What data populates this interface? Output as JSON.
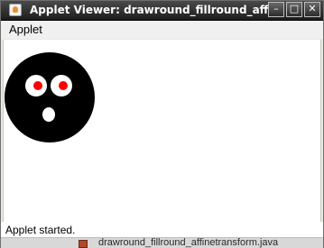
{
  "window": {
    "title": "Applet Viewer: drawround_fillround_affinetr...",
    "buttons": {
      "minimize": "–",
      "maximize": "□",
      "close": "✕"
    }
  },
  "menubar": {
    "items": [
      {
        "label": "Applet"
      }
    ]
  },
  "applet_drawing": {
    "face_color": "#000000",
    "eye_white_color": "#ffffff",
    "pupil_color": "#ff0000",
    "mouth_color": "#ffffff"
  },
  "status": {
    "text": "Applet started."
  },
  "taskbar_hint": {
    "file_name": "drawround_fillround_affinetransform.java"
  }
}
